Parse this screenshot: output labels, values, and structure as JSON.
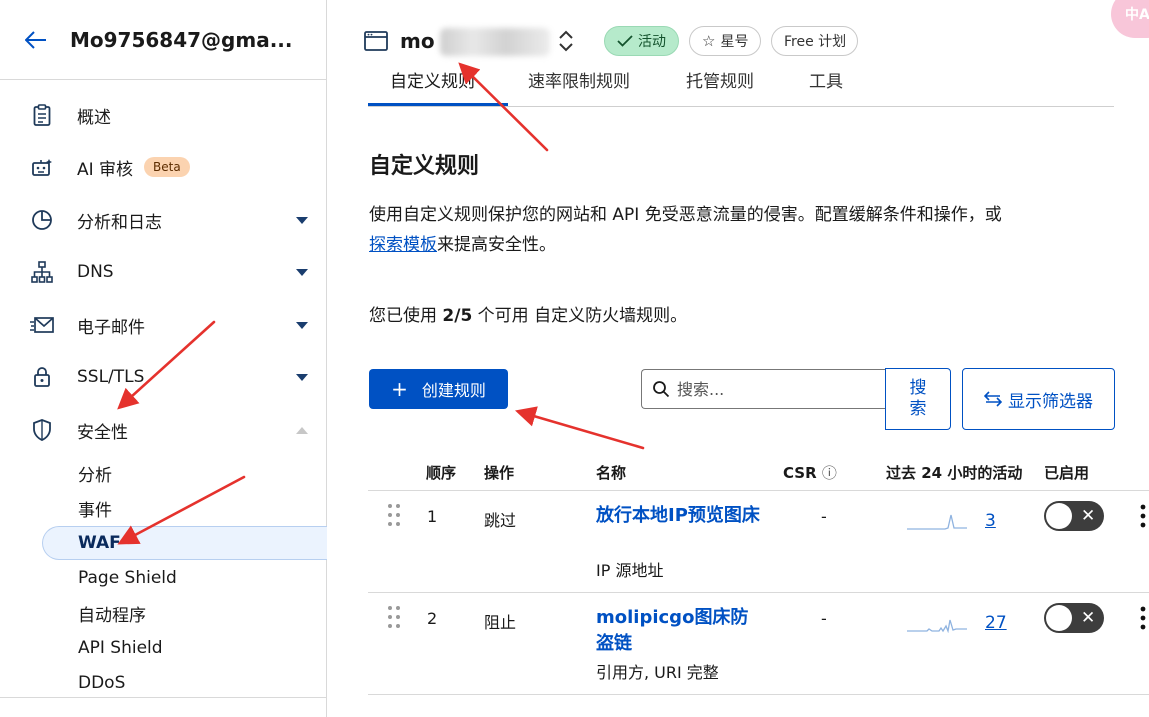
{
  "sidebar": {
    "account": "Mo9756847@gma...",
    "nav": [
      {
        "label": "概述",
        "icon": "clipboard-icon"
      },
      {
        "label": "AI 审核",
        "icon": "robot-icon",
        "badge": "Beta"
      },
      {
        "label": "分析和日志",
        "icon": "pie-chart-icon"
      },
      {
        "label": "DNS",
        "icon": "network-icon"
      },
      {
        "label": "电子邮件",
        "icon": "envelope-icon"
      },
      {
        "label": "SSL/TLS",
        "icon": "lock-icon"
      },
      {
        "label": "安全性",
        "icon": "shield-icon"
      }
    ],
    "security_sub": [
      "分析",
      "事件",
      "WAF",
      "Page Shield",
      "自动程序",
      "API Shield",
      "DDoS"
    ]
  },
  "header": {
    "site_name_visible": "mo",
    "status_pill": "活动",
    "star_pill": "星号",
    "plan_pill": "Free 计划",
    "corner_text": "中A"
  },
  "tabs": [
    "自定义规则",
    "速率限制规则",
    "托管规则",
    "工具"
  ],
  "main": {
    "title": "自定义规则",
    "desc_before": "使用自定义规则保护您的网站和 API 免受恶意流量的侵害。配置缓解条件和操作，或",
    "desc_link": "探索模板",
    "desc_after": "来提高安全性。",
    "usage_before": "您已使用 ",
    "usage_count": "2/5",
    "usage_after": " 个可用 自定义防火墙规则。",
    "create_button": "创建规则",
    "search_placeholder": "搜索...",
    "search_button_line1": "搜",
    "search_button_line2": "索",
    "filter_button": "显示筛选器"
  },
  "table": {
    "columns": {
      "order": "顺序",
      "action": "操作",
      "name": "名称",
      "csr": "CSR",
      "activity": "过去 24 小时的活动",
      "enabled": "已启用"
    },
    "rows": [
      {
        "order": "1",
        "action": "跳过",
        "name": "放行本地IP预览图床",
        "condition": "IP 源地址",
        "csr": "-",
        "count": "3"
      },
      {
        "order": "2",
        "action": "阻止",
        "name": "molipicgo图床防盗链",
        "condition": "引用方, URI 完整",
        "csr": "-",
        "count": "27"
      }
    ]
  },
  "colors": {
    "brand_blue": "#0051c3",
    "active_green": "#b6eacb",
    "beta_orange": "#fbd3b0",
    "annotation_red": "#e5322d"
  }
}
